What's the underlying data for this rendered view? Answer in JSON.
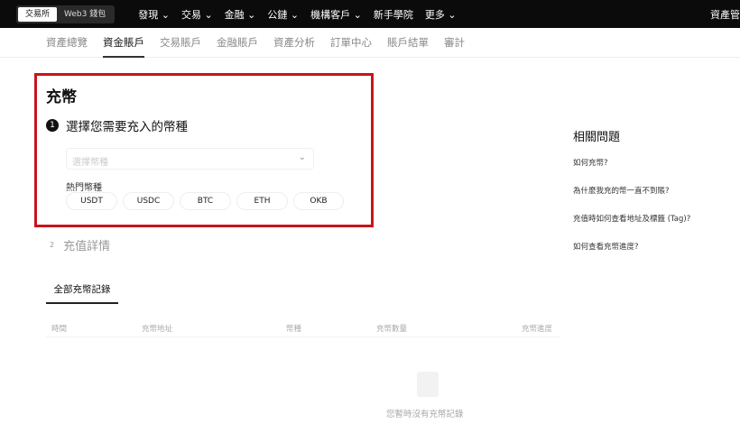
{
  "topbar": {
    "segments": [
      "交易所",
      "Web3 錢包"
    ],
    "nav": [
      "發現 ⌄",
      "交易 ⌄",
      "金融 ⌄",
      "公鏈 ⌄",
      "機構客戶 ⌄",
      "新手學院",
      "更多 ⌄"
    ],
    "right": "資產管"
  },
  "subnav": [
    "資產總覽",
    "資金賬戶",
    "交易賬戶",
    "金融賬戶",
    "資產分析",
    "訂單中心",
    "賬戶結單",
    "審計"
  ],
  "deposit": {
    "title": "充幣",
    "step1_num": "1",
    "step1": "選擇您需要充入的幣種",
    "placeholder": "選擇幣種",
    "hot_label": "熱門幣種",
    "coins": [
      "USDT",
      "USDC",
      "BTC",
      "ETH",
      "OKB"
    ],
    "step2_num": "2",
    "step2": "充值詳情"
  },
  "records": {
    "tab": "全部充幣記錄",
    "headers": [
      "時間",
      "充幣地址",
      "幣種",
      "充幣數量",
      "充幣進度"
    ],
    "empty": "您暫時沒有充幣記錄"
  },
  "faq": {
    "title": "相關問題",
    "items": [
      "如何充幣?",
      "為什麼我充的幣一直不到賬?",
      "充值時如何查看地址及標籤 (Tag)?",
      "如何查看充幣進度?"
    ]
  }
}
